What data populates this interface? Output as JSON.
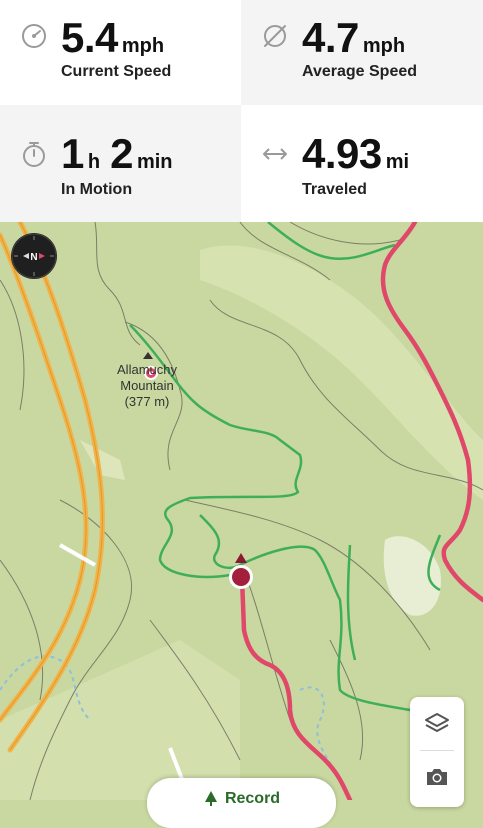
{
  "stats": {
    "current_speed": {
      "value": "5.4",
      "unit": "mph",
      "label": "Current Speed",
      "icon": "speedometer-icon"
    },
    "average_speed": {
      "value": "4.7",
      "unit": "mph",
      "label": "Average Speed",
      "icon": "average-icon"
    },
    "in_motion": {
      "hours": "1",
      "hours_unit": "h",
      "minutes": "2",
      "minutes_unit": "min",
      "label": "In Motion",
      "icon": "stopwatch-icon"
    },
    "traveled": {
      "value": "4.93",
      "unit": "mi",
      "label": "Traveled",
      "icon": "distance-icon"
    }
  },
  "map": {
    "peak": {
      "name_line1": "Allamuchy",
      "name_line2": "Mountain",
      "elevation": "(377 m)"
    },
    "compass": {
      "letter": "N"
    },
    "colors": {
      "route": "#e0486a",
      "trail": "#3fae5a",
      "highway": "#f2b34a",
      "terrain": "#c9d8a0",
      "marker": "#a3203c"
    }
  },
  "controls": {
    "layers_icon": "layers-icon",
    "camera_icon": "camera-icon"
  },
  "bottom_action": {
    "label": "Record"
  }
}
